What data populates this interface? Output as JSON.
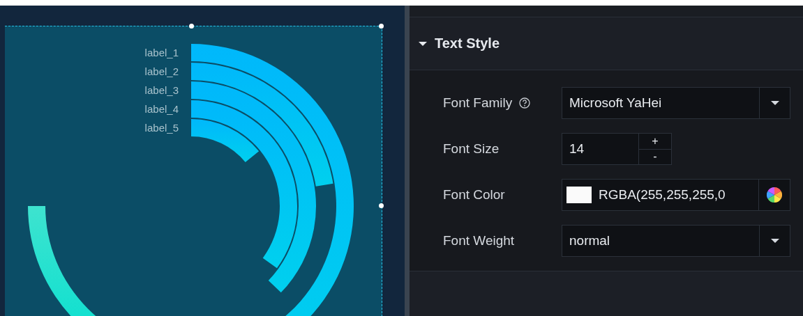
{
  "chart": {
    "labels": [
      "label_1",
      "label_2",
      "label_3",
      "label_4",
      "label_5"
    ]
  },
  "panel": {
    "section": {
      "title": "Text Style",
      "expanded": true
    },
    "fields": [
      {
        "kind": "select",
        "label": "Font Family",
        "help": true,
        "value": "Microsoft YaHei"
      },
      {
        "kind": "number",
        "label": "Font Size",
        "value": "14",
        "plus": "+",
        "minus": "-"
      },
      {
        "kind": "color",
        "label": "Font Color",
        "value": "RGBA(255,255,255,0"
      },
      {
        "kind": "select",
        "label": "Font Weight",
        "help": false,
        "value": "normal"
      }
    ]
  }
}
